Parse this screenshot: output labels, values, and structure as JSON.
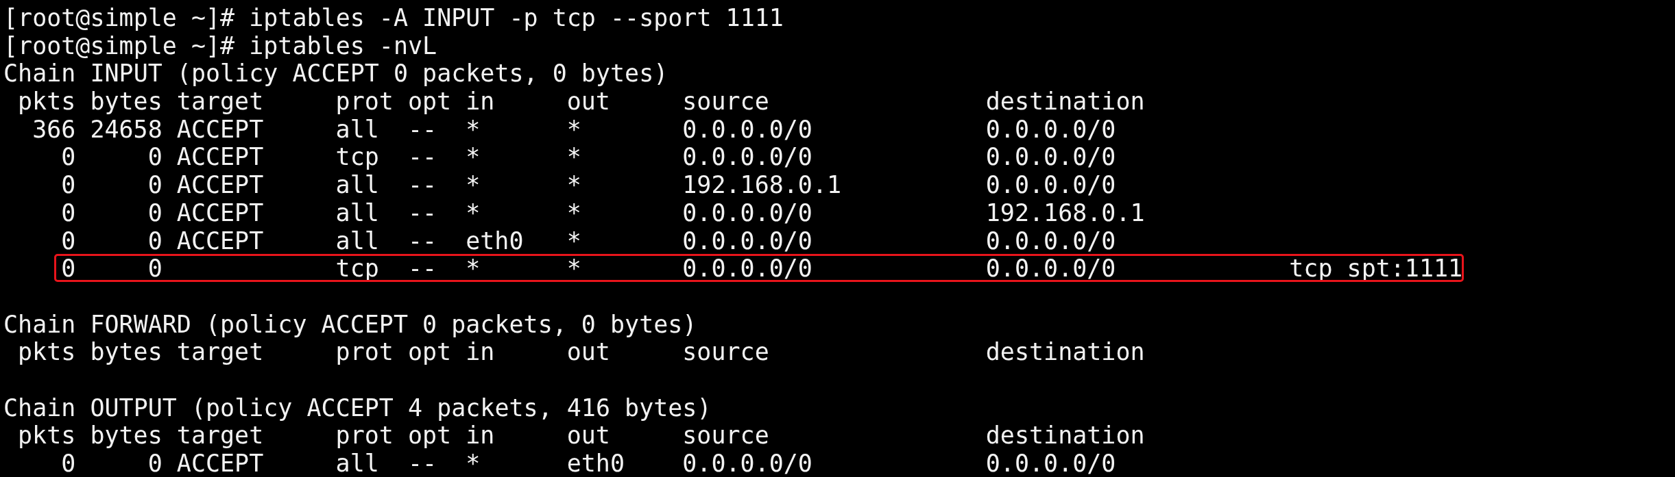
{
  "lines": [
    {
      "kind": "command",
      "text": "[root@simple ~]# iptables -A INPUT -p tcp --sport 1111"
    },
    {
      "kind": "command",
      "text": "[root@simple ~]# iptables -nvL"
    },
    {
      "kind": "chain",
      "title": "Chain INPUT (policy ACCEPT 0 packets, 0 bytes)",
      "columns": [
        "pkts",
        "bytes",
        "target",
        "prot",
        "opt",
        "in",
        "out",
        "source",
        "destination"
      ],
      "rows": [
        {
          "pkts": "366",
          "bytes": "24658",
          "target": "ACCEPT",
          "prot": "all",
          "opt": "--",
          "in": "*",
          "out": "*",
          "source": "0.0.0.0/0",
          "destination": "0.0.0.0/0",
          "highlighted": false
        },
        {
          "pkts": "0",
          "bytes": "0",
          "target": "ACCEPT",
          "prot": "tcp",
          "opt": "--",
          "in": "*",
          "out": "*",
          "source": "0.0.0.0/0",
          "destination": "0.0.0.0/0",
          "highlighted": false
        },
        {
          "pkts": "0",
          "bytes": "0",
          "target": "ACCEPT",
          "prot": "all",
          "opt": "--",
          "in": "*",
          "out": "*",
          "source": "192.168.0.1",
          "destination": "0.0.0.0/0",
          "highlighted": false
        },
        {
          "pkts": "0",
          "bytes": "0",
          "target": "ACCEPT",
          "prot": "all",
          "opt": "--",
          "in": "*",
          "out": "*",
          "source": "0.0.0.0/0",
          "destination": "192.168.0.1",
          "highlighted": false
        },
        {
          "pkts": "0",
          "bytes": "0",
          "target": "ACCEPT",
          "prot": "all",
          "opt": "--",
          "in": "eth0",
          "out": "*",
          "source": "0.0.0.0/0",
          "destination": "0.0.0.0/0",
          "highlighted": false
        },
        {
          "pkts": "0",
          "bytes": "0",
          "prot": "tcp",
          "opt": "--",
          "in": "*",
          "out": "*",
          "source": "0.0.0.0/0",
          "destination": "0.0.0.0/0",
          "extra": "tcp spt:1111",
          "highlighted": true
        }
      ]
    },
    {
      "kind": "blank"
    },
    {
      "kind": "chain",
      "title": "Chain FORWARD (policy ACCEPT 0 packets, 0 bytes)",
      "columns": [
        "pkts",
        "bytes",
        "target",
        "prot",
        "opt",
        "in",
        "out",
        "source",
        "destination"
      ]
    },
    {
      "kind": "blank"
    },
    {
      "kind": "chain",
      "title": "Chain OUTPUT (policy ACCEPT 4 packets, 416 bytes)",
      "columns": [
        "pkts",
        "bytes",
        "target",
        "prot",
        "opt",
        "in",
        "out",
        "source",
        "destination"
      ],
      "rows": [
        {
          "pkts": "0",
          "bytes": "0",
          "target": "ACCEPT",
          "prot": "all",
          "opt": "--",
          "in": "*",
          "out": "eth0",
          "source": "0.0.0.0/0",
          "destination": "0.0.0.0/0",
          "highlighted": false
        }
      ]
    }
  ]
}
